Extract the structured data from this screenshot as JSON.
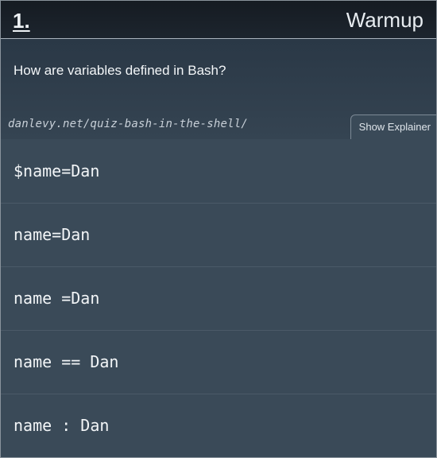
{
  "header": {
    "number": "1.",
    "title": "Warmup"
  },
  "question": {
    "text": "How are variables defined in Bash?"
  },
  "source": {
    "url": "danlevy.net/quiz-bash-in-the-shell/"
  },
  "explainer_button": {
    "label": "Show Explainer"
  },
  "options": [
    {
      "text": "$name=Dan"
    },
    {
      "text": "name=Dan"
    },
    {
      "text": "name =Dan"
    },
    {
      "text": "name == Dan"
    },
    {
      "text": "name : Dan"
    }
  ]
}
